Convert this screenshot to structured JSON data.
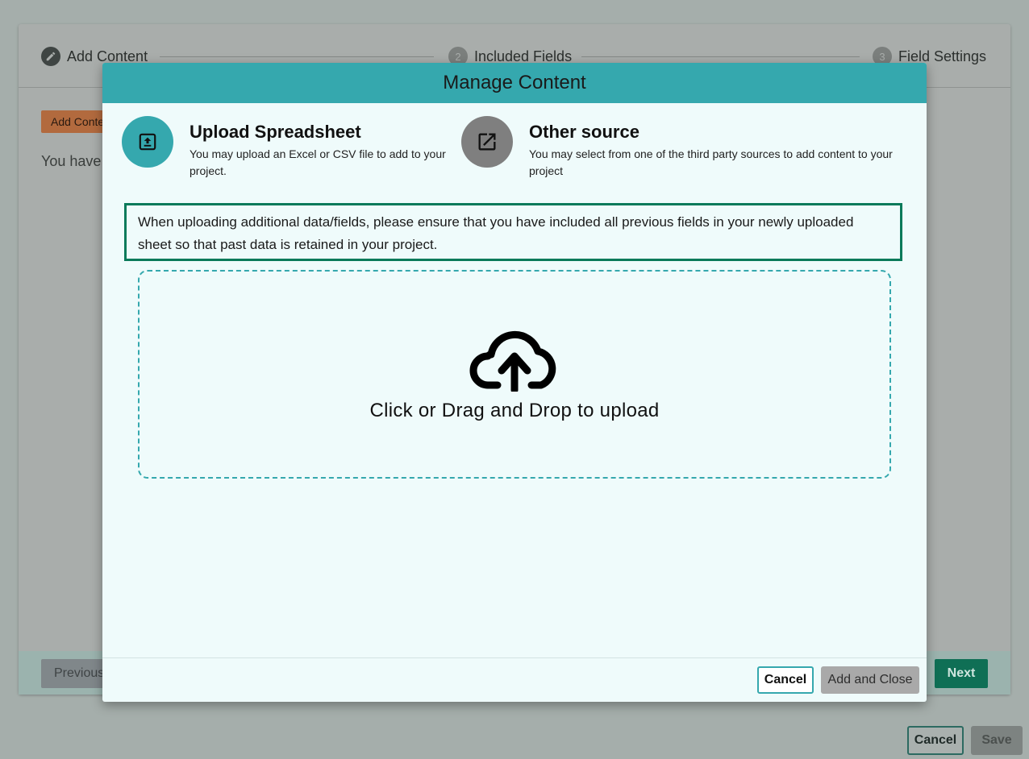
{
  "stepper": {
    "steps": [
      {
        "number": "",
        "label": "Add Content",
        "icon": "pencil-icon"
      },
      {
        "number": "2",
        "label": "Included Fields"
      },
      {
        "number": "3",
        "label": "Field Settings"
      }
    ]
  },
  "background": {
    "add_content_label": "Add Content",
    "info_text": "You have",
    "previous_label": "Previous",
    "next_label": "Next",
    "cancel_label": "Cancel",
    "save_label": "Save"
  },
  "modal": {
    "title": "Manage Content",
    "options": [
      {
        "title": "Upload Spreadsheet",
        "description": "You may upload an Excel or CSV file to add to your project.",
        "icon": "upload-icon"
      },
      {
        "title": "Other source",
        "description": "You may select from one of the third party sources to add content to your project",
        "icon": "external-link-icon"
      }
    ],
    "notice": "When uploading additional data/fields, please ensure that you have included all previous fields in your newly uploaded sheet so that past data is retained in your project.",
    "dropzone": {
      "text": "Click or Drag and Drop to upload",
      "icon": "cloud-upload-icon"
    },
    "cancel_label": "Cancel",
    "add_close_label": "Add and Close"
  },
  "colors": {
    "accent": "#35a8ae",
    "notice_border": "#0a7a5a",
    "modal_bg": "#effbfb"
  }
}
